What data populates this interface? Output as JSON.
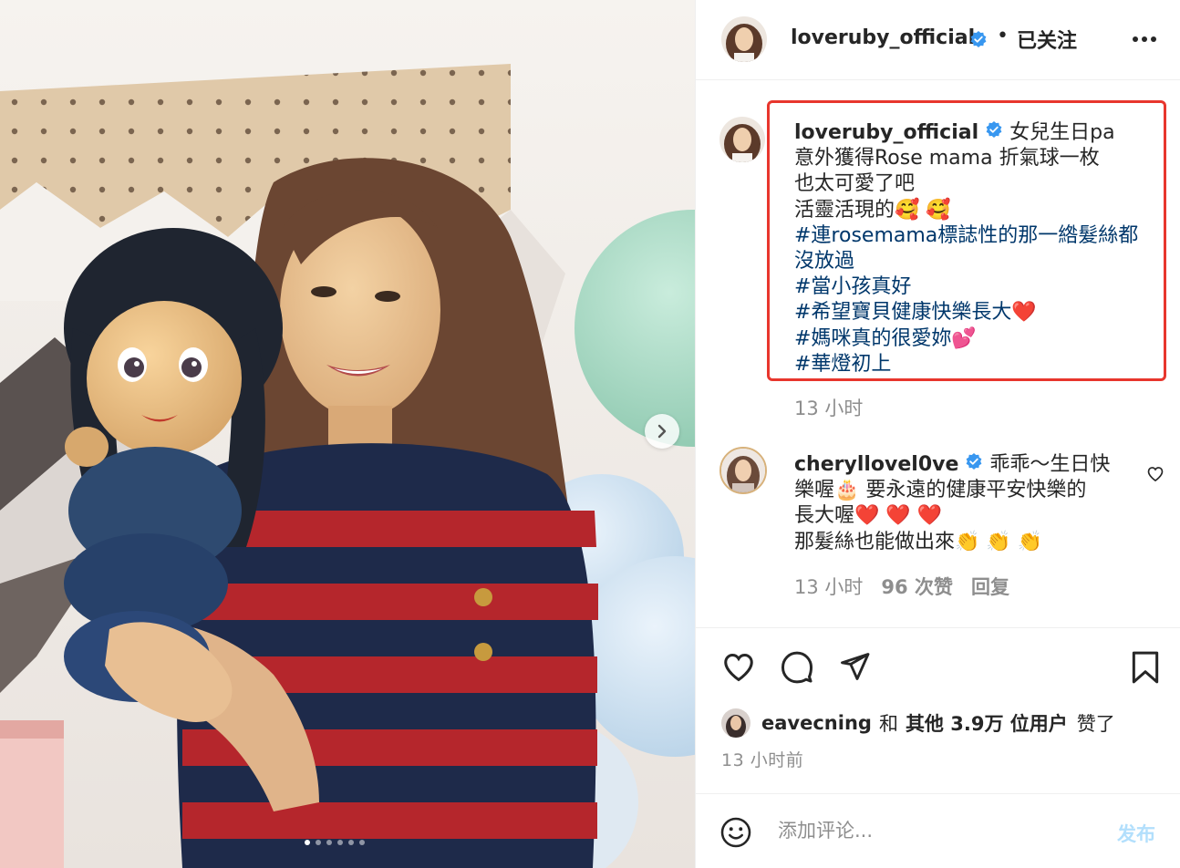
{
  "post": {
    "username": "loveruby_official",
    "follow_status": "已关注",
    "separator": "•"
  },
  "caption": {
    "username": "loveruby_official",
    "lines": [
      {
        "text": "女兒生日pa",
        "tag": false
      },
      {
        "text": "意外獲得Rose mama 折氣球一枚",
        "tag": false
      },
      {
        "text": "也太可愛了吧",
        "tag": false
      },
      {
        "text": "活靈活現的🥰 🥰",
        "tag": false
      },
      {
        "text": "#連rosemama標誌性的那一綹髮絲都",
        "tag": true
      },
      {
        "text": "沒放過",
        "tag": true
      },
      {
        "text": "#當小孩真好",
        "tag": true
      },
      {
        "text": "#希望寶貝健康快樂長大❤️",
        "tag": true
      },
      {
        "text": "#媽咪真的很愛妳💕",
        "tag": true
      },
      {
        "text": "#華燈初上",
        "tag": true
      }
    ],
    "time": "13 小时"
  },
  "comment": {
    "username": "cheryllovel0ve",
    "lines": [
      "乖乖～生日快",
      "樂喔🎂 要永遠的健康平安快樂的",
      "長大喔❤️ ❤️ ❤️",
      "那髮絲也能做出來👏 👏 👏"
    ],
    "time": "13 小时",
    "likes": "96 次赞",
    "reply": "回复"
  },
  "likes": {
    "user": "eavecning",
    "and": "和",
    "others": "其他 3.9万 位用户",
    "suffix": "赞了"
  },
  "post_time": "13 小时前",
  "comment_box": {
    "placeholder": "添加评论...",
    "post_label": "发布"
  },
  "colors": {
    "highlight_box": "#e8362d",
    "hashtag": "#00376b",
    "verified": "#3897f0",
    "post_button": "#b2dffc"
  },
  "carousel": {
    "count": 6,
    "active": 0
  }
}
